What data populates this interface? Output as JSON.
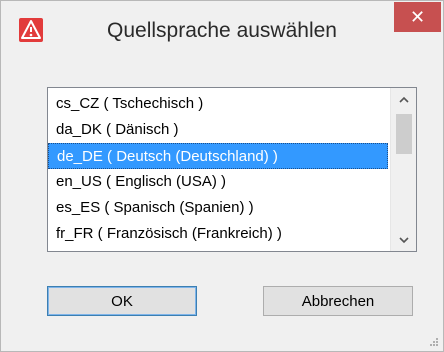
{
  "dialog": {
    "title": "Quellsprache auswählen",
    "close_label": "✕",
    "accent": "#c75050",
    "selection_color": "#3399ff"
  },
  "languages": [
    "cs_CZ ( Tschechisch )",
    "da_DK ( Dänisch )",
    "de_DE ( Deutsch (Deutschland) )",
    "en_US ( Englisch (USA) )",
    "es_ES ( Spanisch (Spanien) )",
    "fr_FR ( Französisch (Frankreich) )"
  ],
  "selected_index": 2,
  "buttons": {
    "ok": "OK",
    "cancel": "Abbrechen"
  },
  "icons": {
    "app": "warning-app-icon",
    "scroll_up": "chevron-up-icon",
    "scroll_down": "chevron-down-icon",
    "resize": "resize-grip-icon"
  }
}
